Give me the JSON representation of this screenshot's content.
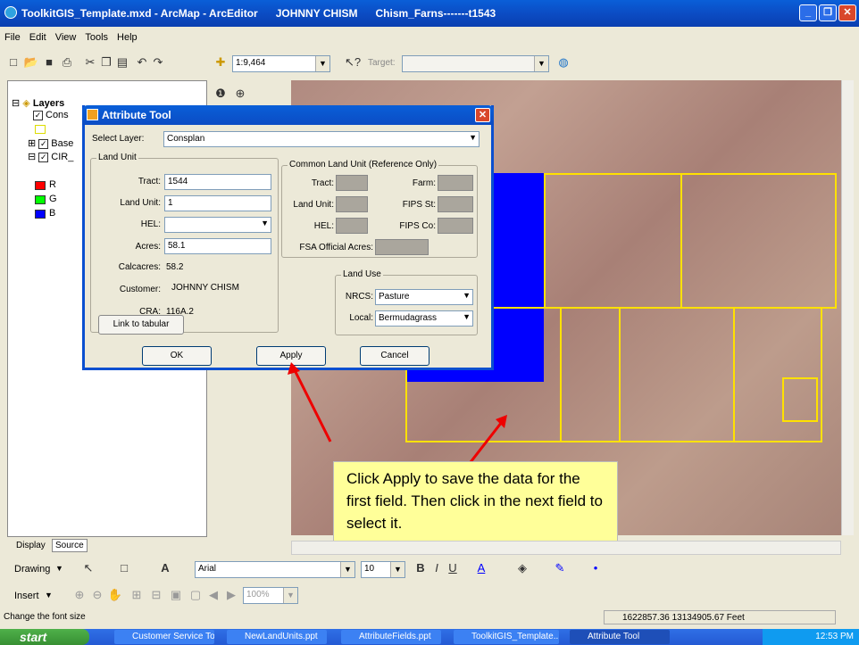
{
  "window": {
    "title": "ToolkitGIS_Template.mxd - ArcMap - ArcEditor      JOHNNY CHISM      Chism_Farns-------t1543"
  },
  "menu": [
    "File",
    "Edit",
    "View",
    "Tools",
    "Help"
  ],
  "toolbar": {
    "scale": "1:9,464",
    "target_label": "Target:"
  },
  "toc": {
    "root": "Layers",
    "layers": [
      "Cons",
      "Base",
      "CIR_"
    ],
    "legend": [
      "R",
      "G",
      "B"
    ],
    "tabs": [
      "Display",
      "Source"
    ]
  },
  "colors": {
    "red": "#ff0000",
    "green": "#00ff00",
    "blue": "#0000ff",
    "parcel": "#ffe100"
  },
  "dialog": {
    "title": "Attribute Tool",
    "select_layer_label": "Select Layer:",
    "select_layer_value": "Consplan",
    "land_unit_group": "Land Unit",
    "tract_label": "Tract:",
    "tract_value": "1544",
    "land_unit_label": "Land Unit:",
    "land_unit_value": "1",
    "hel_label": "HEL:",
    "hel_value": "",
    "acres_label": "Acres:",
    "acres_value": "58.1",
    "calcacres_label": "Calcacres:",
    "calcacres_value": "58.2",
    "customer_label": "Customer:",
    "customer_value": "JOHNNY CHISM",
    "cra_label": "CRA:",
    "cra_value": "116A.2",
    "link_button": "Link to tabular",
    "clu_group": "Common Land Unit (Reference Only)",
    "clu_tract": "Tract:",
    "clu_farm": "Farm:",
    "clu_landunit": "Land Unit:",
    "clu_fipsst": "FIPS St:",
    "clu_hel": "HEL:",
    "clu_fipsco": "FIPS Co:",
    "clu_fsa": "FSA Official Acres:",
    "land_use_group": "Land Use",
    "nrcs_label": "NRCS:",
    "nrcs_value": "Pasture",
    "local_label": "Local:",
    "local_value": "Bermudagrass",
    "ok": "OK",
    "apply": "Apply",
    "cancel": "Cancel"
  },
  "callout": "Click Apply to save the data for the first field. Then click in the next field to select it.",
  "drawing": {
    "drawing_label": "Drawing",
    "font": "Arial",
    "size": "10",
    "insert_label": "Insert",
    "zoom": "100%"
  },
  "status": {
    "text": "Change the font size",
    "coords": "1622857.36  13134905.67 Feet"
  },
  "taskbar": {
    "start": "start",
    "tasks": [
      "Customer Service To...",
      "NewLandUnits.ppt",
      "AttributeFields.ppt",
      "ToolkitGIS_Template...",
      "Attribute Tool"
    ],
    "time": "12:53 PM"
  }
}
